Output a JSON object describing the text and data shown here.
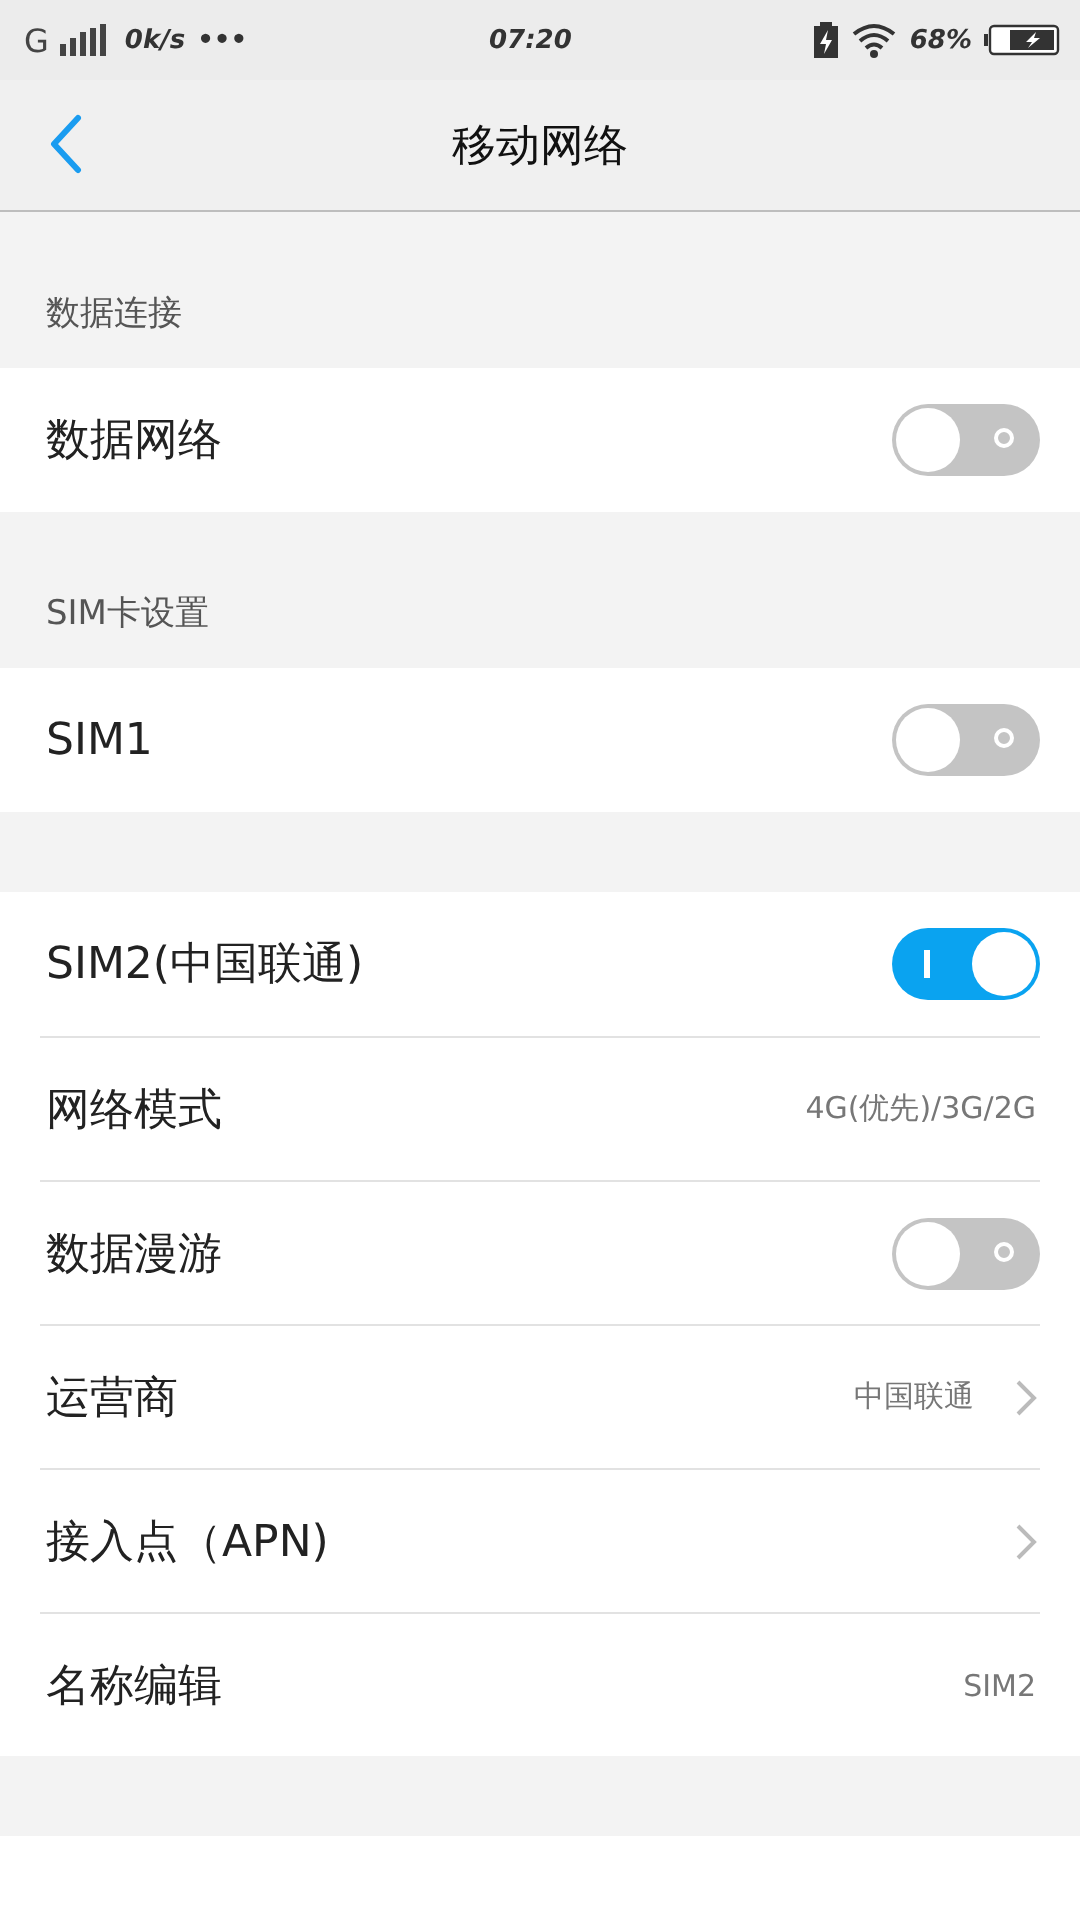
{
  "status_bar": {
    "network": "G",
    "speed": "0k/s",
    "more": "•••",
    "time": "07:20",
    "battery_percent": "68%"
  },
  "header": {
    "title": "移动网络"
  },
  "sections": [
    {
      "title": "数据连接",
      "rows": [
        {
          "kind": "toggle",
          "label": "数据网络",
          "on": false
        }
      ]
    },
    {
      "title": "SIM卡设置",
      "rows": [
        {
          "kind": "toggle",
          "label": "SIM1",
          "on": false
        }
      ]
    },
    {
      "rows": [
        {
          "kind": "toggle",
          "label": "SIM2(中国联通)",
          "on": true
        },
        {
          "kind": "value",
          "label": "网络模式",
          "value": "4G(优先)/3G/2G"
        },
        {
          "kind": "toggle",
          "label": "数据漫游",
          "on": false
        },
        {
          "kind": "link",
          "label": "运营商",
          "value": "中国联通"
        },
        {
          "kind": "link",
          "label": "接入点（APN)"
        },
        {
          "kind": "value",
          "label": "名称编辑",
          "value": "SIM2"
        }
      ]
    }
  ]
}
